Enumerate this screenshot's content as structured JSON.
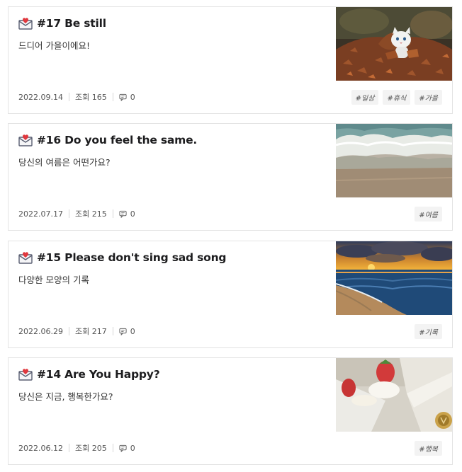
{
  "posts": [
    {
      "title": "#17 Be still",
      "description": "드디어 가을이에요!",
      "date": "2022.09.14",
      "views": "조회 165",
      "comments": "0",
      "tags": [
        "#일상",
        "#휴식",
        "#가을"
      ]
    },
    {
      "title": "#16 Do you feel the same.",
      "description": "당신의 여름은 어떤가요?",
      "date": "2022.07.17",
      "views": "조회 215",
      "comments": "0",
      "tags": [
        "#여름"
      ]
    },
    {
      "title": "#15 Please don't sing sad song",
      "description": "다양한 모양의 기록",
      "date": "2022.06.29",
      "views": "조회 217",
      "comments": "0",
      "tags": [
        "#기록"
      ]
    },
    {
      "title": "#14 Are You Happy?",
      "description": "당신은 지금, 행복한가요?",
      "date": "2022.06.12",
      "views": "조회 205",
      "comments": "0",
      "tags": [
        "#행복"
      ]
    }
  ]
}
